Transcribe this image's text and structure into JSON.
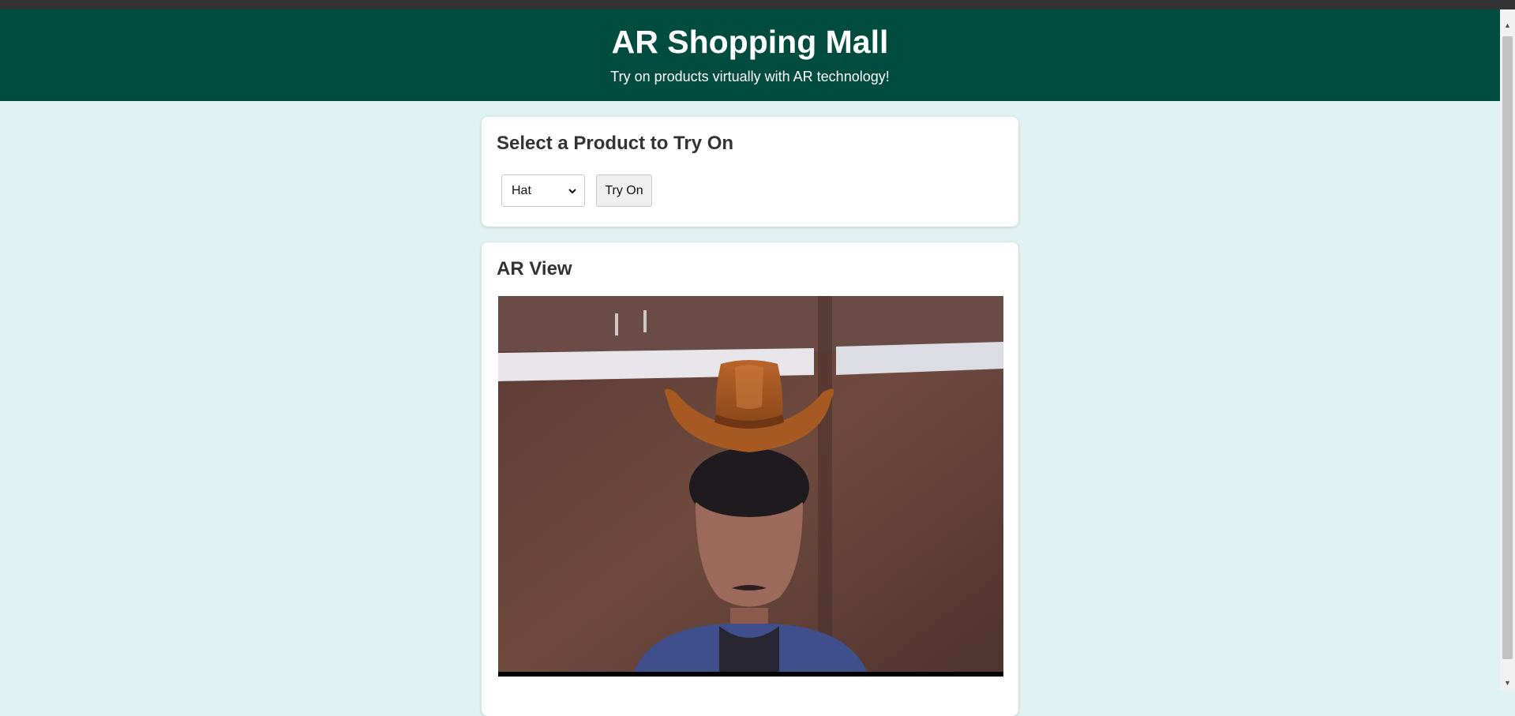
{
  "header": {
    "title": "AR Shopping Mall",
    "subtitle": "Try on products virtually with AR technology!"
  },
  "product_section": {
    "heading": "Select a Product to Try On",
    "selected_product": "Hat",
    "try_button_label": "Try On"
  },
  "ar_section": {
    "heading": "AR View",
    "overlay_item": "cowboy-hat"
  },
  "colors": {
    "header_bg": "#004d40",
    "page_bg": "#e0f2f1",
    "card_bg": "#ffffff"
  }
}
